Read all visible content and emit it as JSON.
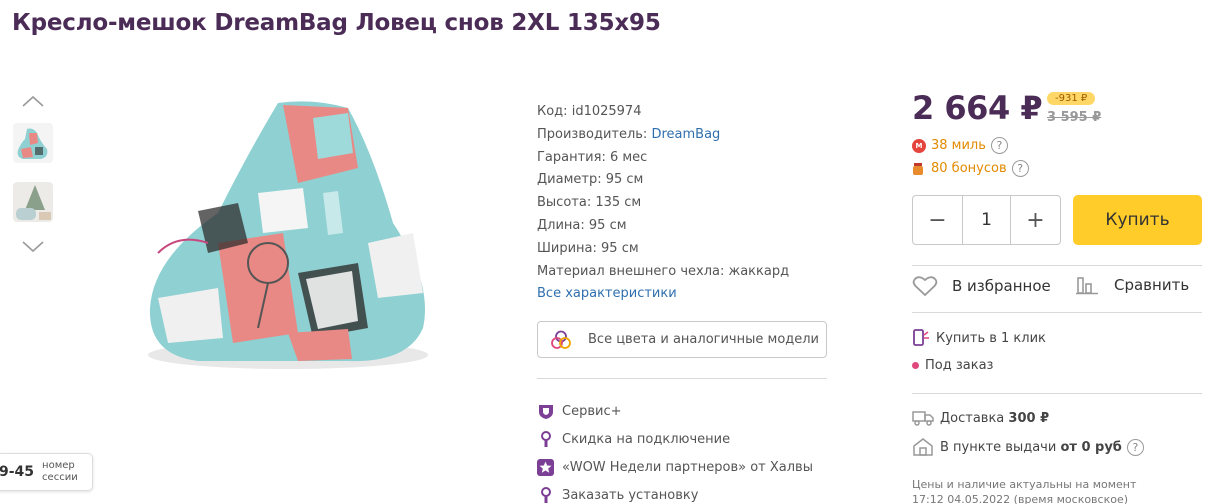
{
  "title": "Кресло-мешок DreamBag Ловец снов 2XL 135x95",
  "specs": {
    "code_label": "Код:",
    "code": "id1025974",
    "maker_label": "Производитель:",
    "maker": "DreamBag",
    "warranty": "Гарантия: 6 мес",
    "diameter": "Диаметр: 95 см",
    "height": "Высота: 135 см",
    "length": "Длина: 95 см",
    "width": "Ширина: 95 см",
    "material": "Материал внешнего чехла: жаккард",
    "all_link": "Все характеристики"
  },
  "colors_button": "Все цвета и аналогичные модели",
  "promos": [
    {
      "label": "Сервис+",
      "icon": "shield-icon"
    },
    {
      "label": "Скидка на подключение",
      "icon": "wrench-icon"
    },
    {
      "label": "«WOW Недели партнеров» от Халвы",
      "icon": "star-icon"
    },
    {
      "label": "Заказать установку",
      "icon": "wrench-icon"
    }
  ],
  "price": {
    "current": "2 664 ₽",
    "discount": "-931 ₽",
    "old": "3 595 ₽"
  },
  "bonuses": {
    "miles": "38 миль",
    "points": "80 бонусов",
    "help": "?"
  },
  "quantity": {
    "minus": "−",
    "value": "1",
    "plus": "+"
  },
  "buy_label": "Купить",
  "favorite_label": "В избранное",
  "compare_label": "Сравнить",
  "one_click": "Купить в 1 клик",
  "availability": "Под заказ",
  "delivery": {
    "label": "Доставка",
    "price": "300 ₽"
  },
  "pickup": {
    "label": "В пункте выдачи",
    "price": "от 0 руб"
  },
  "note": {
    "line1": "Цены и наличие актуальны на момент",
    "line2": "17:12 04.05.2022 (время московское)"
  },
  "session": {
    "number": "9-45",
    "label1": "номер",
    "label2": "сессии"
  },
  "colors": {
    "title": "#4b2c57",
    "buy": "#ffcc29",
    "link": "#2f6fae",
    "miles": "#e28a00",
    "promo_icon": "#7b3f95"
  }
}
